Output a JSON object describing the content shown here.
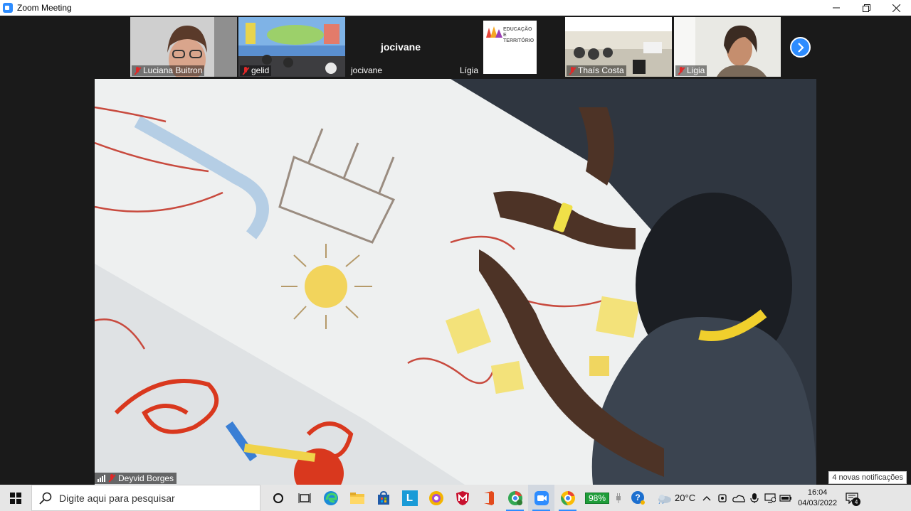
{
  "window": {
    "title": "Zoom Meeting"
  },
  "participants": [
    {
      "name": "Luciana Buitron",
      "muted": true
    },
    {
      "name": "gelid",
      "muted": true
    },
    {
      "name": "jocivane",
      "muted": false,
      "center_name": "jocivane"
    },
    {
      "name": "Lígia",
      "muted": false,
      "logo_text": "EDUCAÇÃO E TERRITÓRIO"
    },
    {
      "name": "Thaís Costa",
      "muted": true
    },
    {
      "name": "Ligia",
      "muted": true
    }
  ],
  "main": {
    "speaker_name": "Deyvid Borges",
    "speaker_muted": true
  },
  "notification": "4 novas notificações",
  "taskbar": {
    "search_placeholder": "Digite aqui para pesquisar",
    "battery": "98%",
    "temperature": "20°C",
    "time": "16:04",
    "date": "04/03/2022",
    "notification_count": "4",
    "app_letter": "L"
  },
  "colors": {
    "zoom_blue": "#2d8cff",
    "muted_red": "#e02828",
    "battery_green": "#1f9d3a"
  }
}
